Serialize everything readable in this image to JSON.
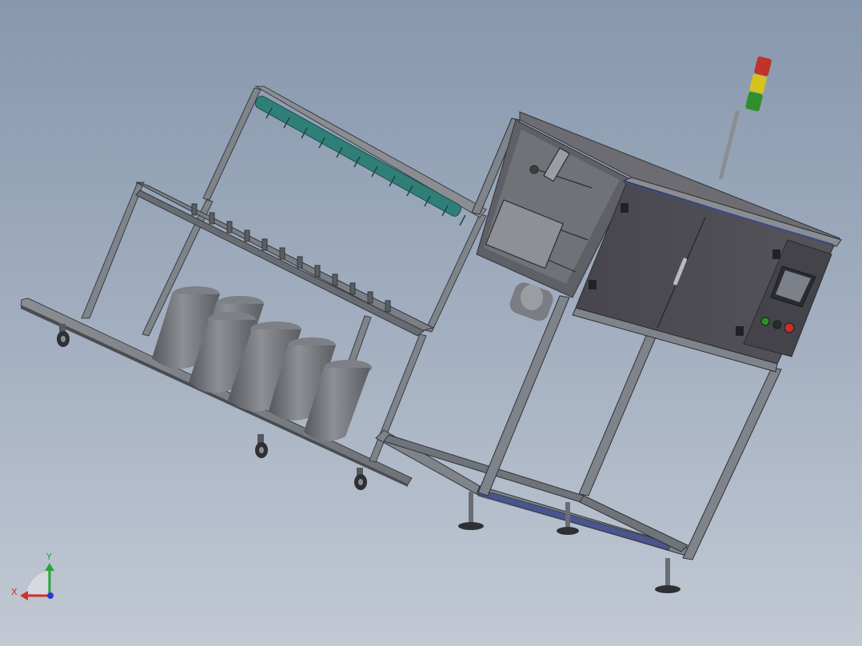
{
  "viewport": {
    "background_top": "#8797ad",
    "background_bottom": "#c2c9d4"
  },
  "triad": {
    "x_label": "X",
    "y_label": "Y",
    "z_label": "",
    "x_color": "#d0302a",
    "y_color": "#2aa63c",
    "z_color": "#2a3ad0"
  },
  "model": {
    "frame_color": "#7f838a",
    "cabinet_color": "#4d4c53",
    "accent_color": "#3c4a8c",
    "bobbin_color": "#2f7f78",
    "stack_light_colors": [
      "#c0322a",
      "#d6c21e",
      "#2f8f2a"
    ]
  }
}
